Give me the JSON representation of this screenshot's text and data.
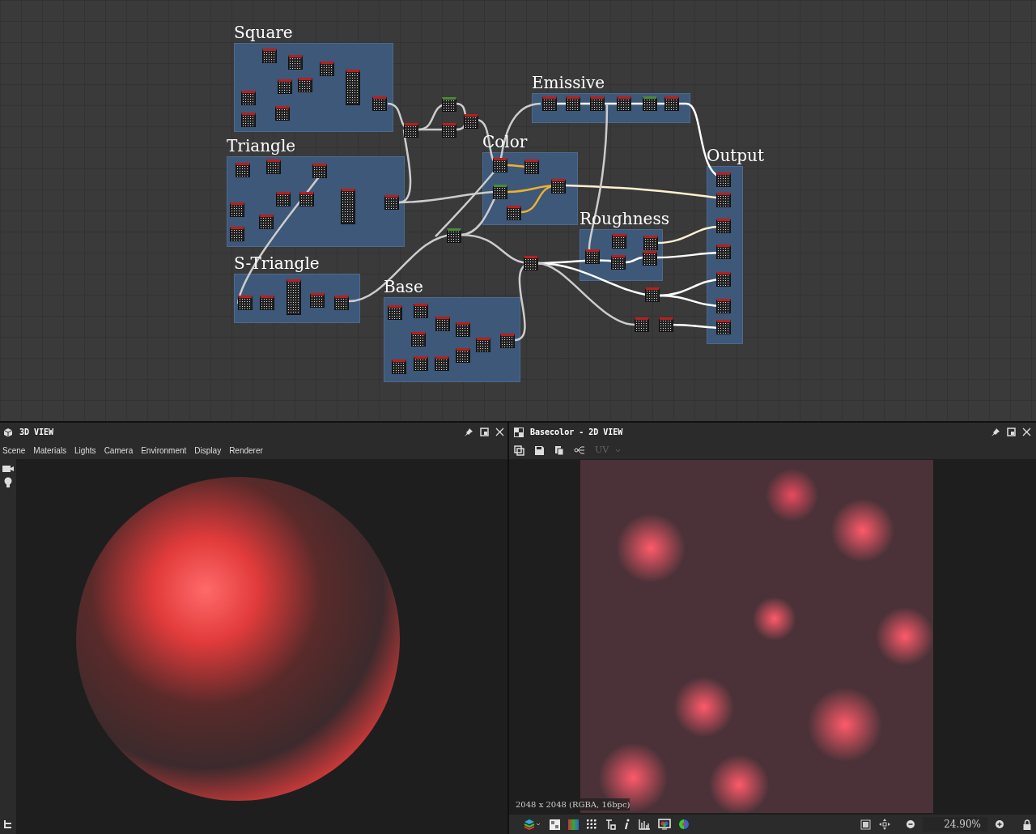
{
  "graph": {
    "frames": [
      {
        "title": "Square"
      },
      {
        "title": "Triangle"
      },
      {
        "title": "S-Triangle"
      },
      {
        "title": "Base"
      },
      {
        "title": "Emissive"
      },
      {
        "title": "Color"
      },
      {
        "title": "Roughness"
      },
      {
        "title": "Output"
      }
    ]
  },
  "view_3d": {
    "title": "3D VIEW",
    "menu": [
      "Scene",
      "Materials",
      "Lights",
      "Camera",
      "Environment",
      "Display",
      "Renderer"
    ]
  },
  "view_2d": {
    "title": "Basecolor - 2D VIEW",
    "channel_dropdown": "UV",
    "image_info": "2048 x 2048 (RGBA, 16bpc)",
    "zoom": "24.90%"
  }
}
